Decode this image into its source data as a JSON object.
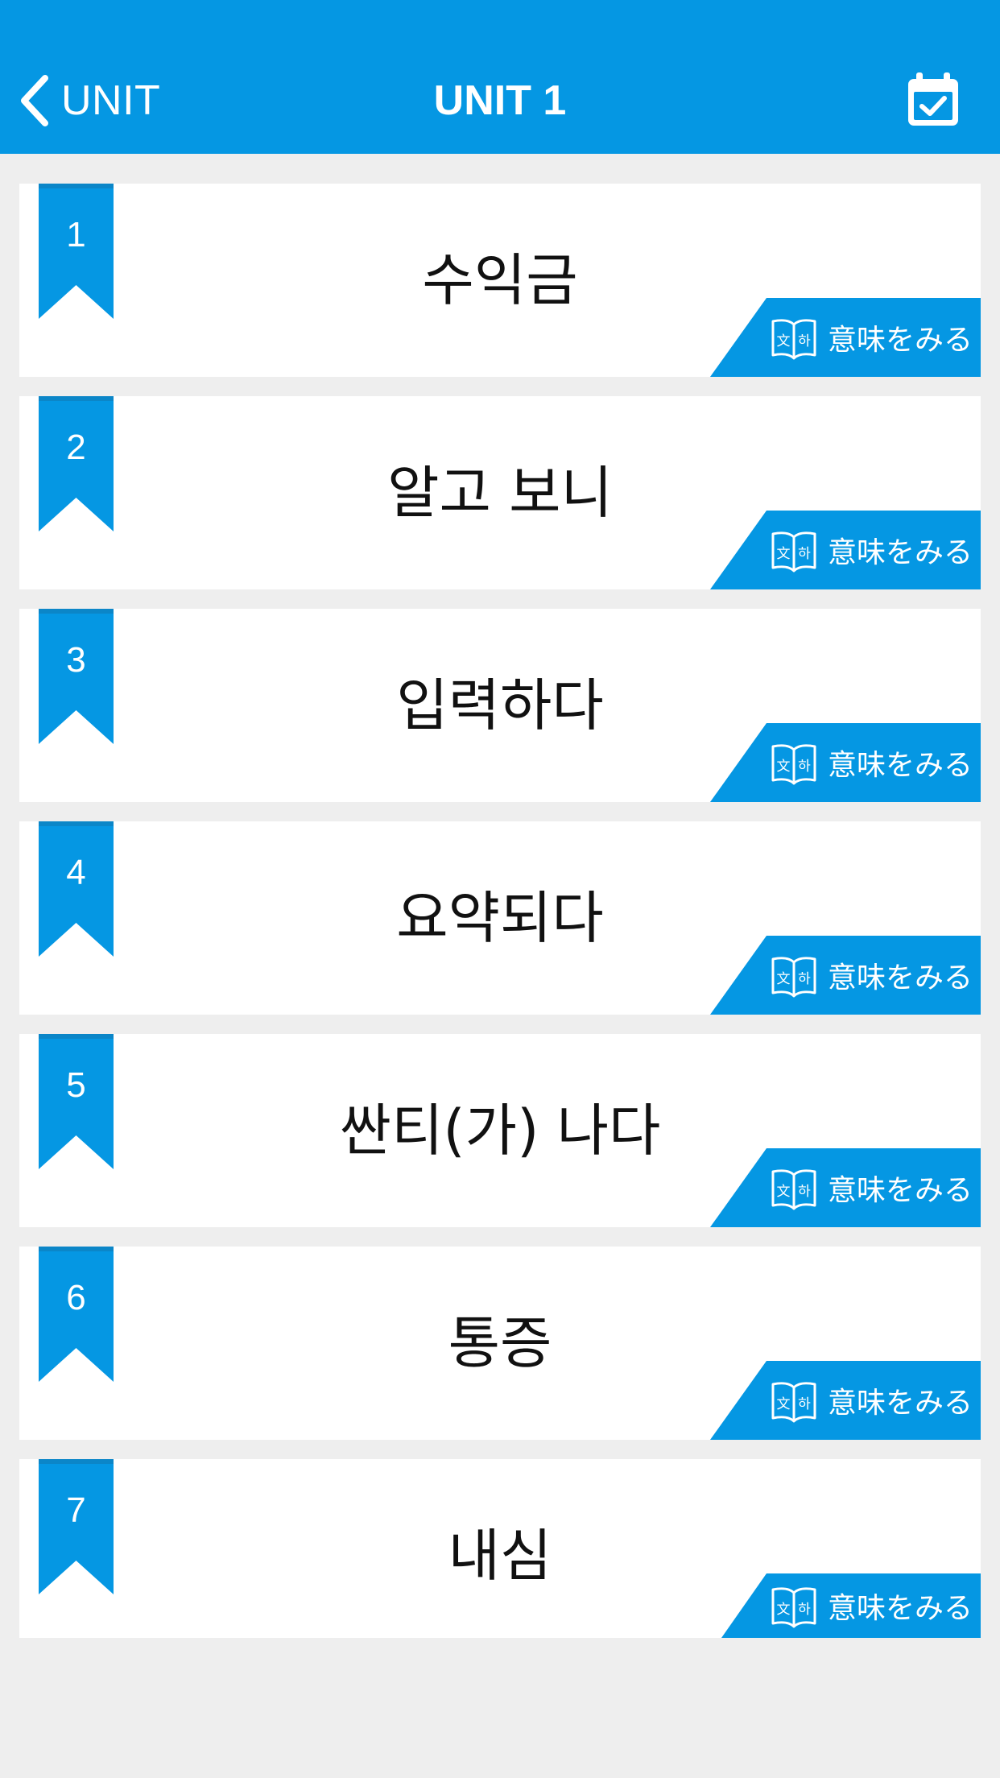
{
  "colors": {
    "accent": "#0597e3",
    "background": "#eeeeee",
    "card": "#ffffff",
    "text": "#111111"
  },
  "nav": {
    "back_label": "UNIT",
    "title": "UNIT 1",
    "back_icon": "chevron-left-icon",
    "right_icon": "calendar-check-icon"
  },
  "items": [
    {
      "number": "1",
      "word": "수익금",
      "meaning_label": "意味をみる"
    },
    {
      "number": "2",
      "word": "알고 보니",
      "meaning_label": "意味をみる"
    },
    {
      "number": "3",
      "word": "입력하다",
      "meaning_label": "意味をみる"
    },
    {
      "number": "4",
      "word": "요약되다",
      "meaning_label": "意味をみる"
    },
    {
      "number": "5",
      "word": "싼티(가) 나다",
      "meaning_label": "意味をみる"
    },
    {
      "number": "6",
      "word": "통증",
      "meaning_label": "意味をみる"
    },
    {
      "number": "7",
      "word": "내심",
      "meaning_label": "意味をみる"
    }
  ],
  "meaning_icon": "open-book-icon"
}
